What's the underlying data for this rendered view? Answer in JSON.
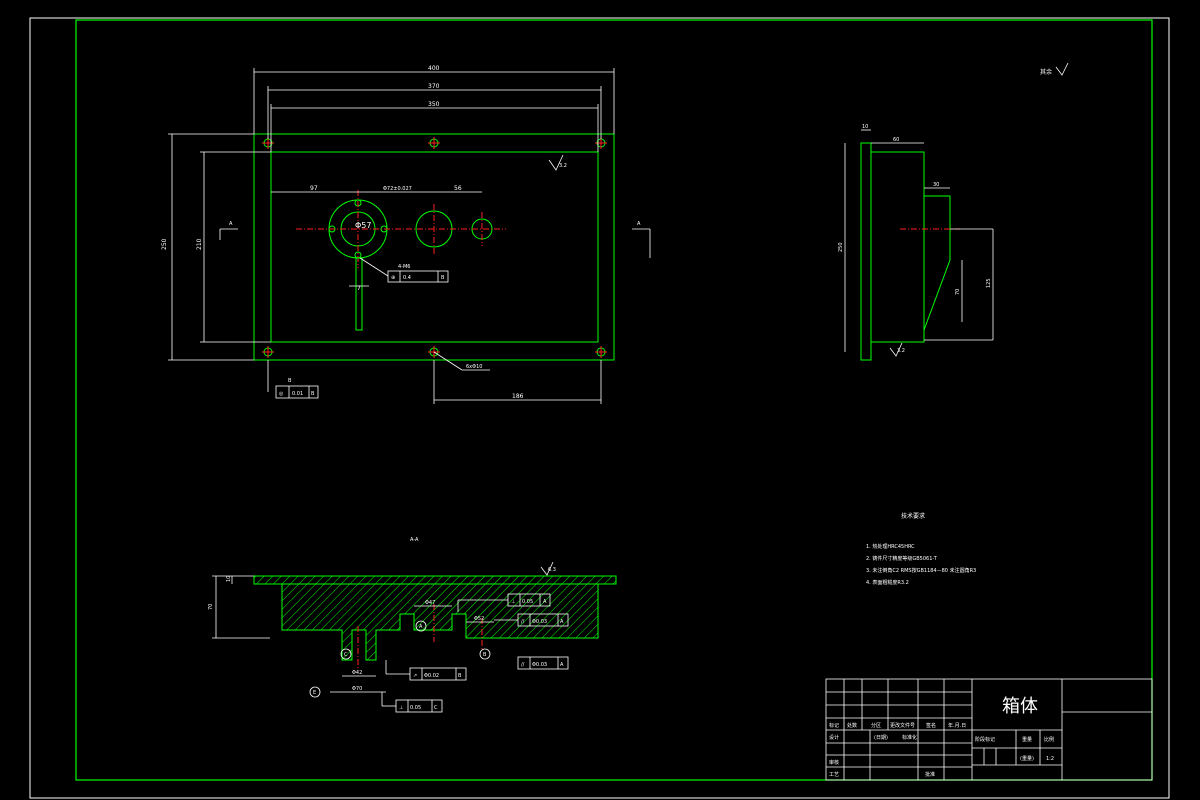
{
  "top_view": {
    "dims": {
      "width_400": "400",
      "width_370": "370",
      "width_350": "350",
      "height_250": "250",
      "height_210": "210",
      "dist_97": "97",
      "bore_tol": "Φ72±0.027",
      "dist_56": "56",
      "bore_57": "Φ57",
      "dist_7": "7",
      "thread_label": "4-M6",
      "pos_tol": "0.4",
      "pos_datum": "B",
      "holes_label": "6xΦ10",
      "dist_186": "186",
      "datum_b": "B",
      "coax_tol": "0.01",
      "coax_datum": "B",
      "roughness": "3.2"
    },
    "section_mark": "A"
  },
  "side_view": {
    "dims": {
      "d10": "10",
      "d60": "60",
      "d30": "30",
      "h250": "250",
      "h70": "70",
      "h125": "125",
      "roughness": "3.2"
    }
  },
  "roughness_note": "其余",
  "section_view": {
    "title": "A-A",
    "dims": {
      "h10": "10",
      "h70": "70",
      "d47": "Φ47",
      "d52": "Φ52",
      "d42": "Φ42",
      "d70": "Φ70",
      "roughness": "6.3"
    },
    "tolerances": [
      {
        "symbol": "⊥",
        "value": "0.05",
        "datum": "A"
      },
      {
        "symbol": "//",
        "value": "Φ0.03",
        "datum": "A"
      },
      {
        "symbol": "//",
        "value": "Φ0.03",
        "datum": "A"
      },
      {
        "symbol": "↗",
        "value": "Φ0.02",
        "datum": "B"
      },
      {
        "symbol": "⊥",
        "value": "0.05",
        "datum": "C"
      }
    ],
    "datum_labels": [
      "A",
      "C",
      "B",
      "E"
    ]
  },
  "tech_requirements": {
    "title": "技术要求",
    "items": [
      "1. 热处理HRC45HRC",
      "2. 铸件尺寸精度等级GB5061-T",
      "3. 未注倒角C2 RMS按GB1184—80 未注圆角R3",
      "4. 表面粗糙度R3.2"
    ]
  },
  "title_block": {
    "part_name": "箱体",
    "row_labels": [
      "标记",
      "处数",
      "分区",
      "更改文件号",
      "签名",
      "年.月.日"
    ],
    "design_row": [
      "设计",
      "",
      "(日期)",
      "标准化"
    ],
    "stage_labels": [
      "阶段标记",
      "重量",
      "比例"
    ],
    "scale": "1:2",
    "weight": "(重量)",
    "review": "审核",
    "process": "工艺",
    "approve": "批准"
  }
}
